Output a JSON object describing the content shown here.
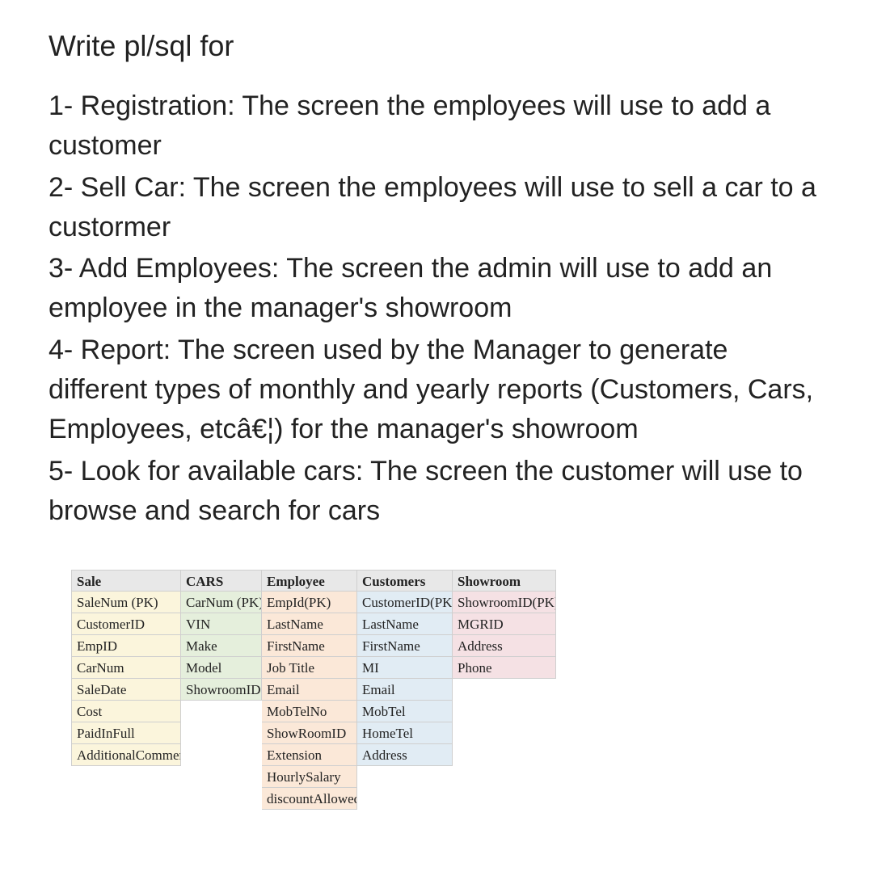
{
  "heading": "Write pl/sql for",
  "items": [
    "1- Registration: The screen the employees will use to add a customer",
    "2- Sell Car: The screen the employees will use to sell a car to a custormer",
    "3- Add Employees: The screen the admin will use to add an employee in the manager's showroom",
    "4- Report: The screen used by the Manager to generate different types of monthly and yearly reports (Customers, Cars, Employees, etcâ€¦) for the manager's showroom",
    "5- Look for available cars: The screen the customer will use to browse and search for cars"
  ],
  "schema": {
    "sale": {
      "header": "Sale",
      "rows": [
        "SaleNum (PK)",
        "CustomerID",
        "EmpID",
        "CarNum",
        "SaleDate",
        "Cost",
        "PaidInFull",
        "AdditionalComments"
      ]
    },
    "cars": {
      "header": "CARS",
      "rows": [
        "CarNum (PK)",
        "VIN",
        "Make",
        "Model",
        "ShowroomID"
      ]
    },
    "employee": {
      "header": "Employee",
      "rows": [
        "EmpId(PK)",
        "LastName",
        "FirstName",
        "Job Title",
        "Email",
        "MobTelNo",
        "ShowRoomID",
        "Extension",
        "HourlySalary",
        "discountAllowed"
      ]
    },
    "customers": {
      "header": "Customers",
      "rows": [
        "CustomerID(PK)",
        "LastName",
        "FirstName",
        "MI",
        "Email",
        "MobTel",
        "HomeTel",
        "Address"
      ]
    },
    "showroom": {
      "header": "Showroom",
      "rows": [
        "ShowroomID(PK)",
        "MGRID",
        "Address",
        "Phone"
      ]
    }
  }
}
